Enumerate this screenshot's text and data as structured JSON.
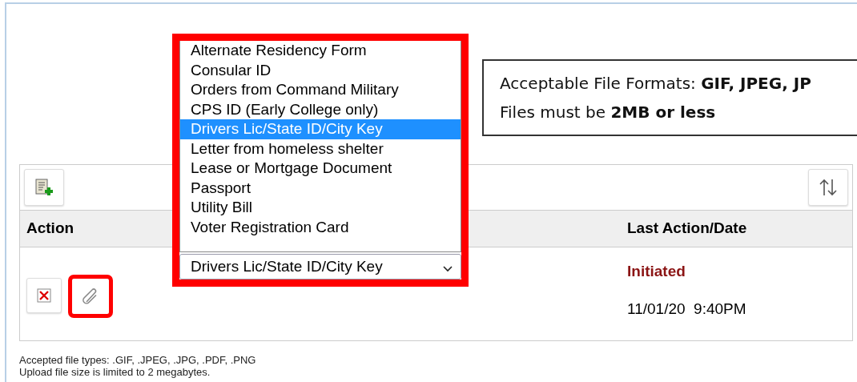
{
  "dropdown": {
    "options": [
      {
        "label": "Alternate Residency Form",
        "selected": false
      },
      {
        "label": "Consular ID",
        "selected": false
      },
      {
        "label": "Orders from Command Military",
        "selected": false
      },
      {
        "label": "CPS ID (Early College only)",
        "selected": false
      },
      {
        "label": "Drivers Lic/State ID/City Key",
        "selected": true
      },
      {
        "label": "Letter from homeless shelter",
        "selected": false
      },
      {
        "label": "Lease or Mortgage Document",
        "selected": false
      },
      {
        "label": "Passport",
        "selected": false
      },
      {
        "label": "Utility Bill",
        "selected": false
      },
      {
        "label": "Voter Registration Card",
        "selected": false
      }
    ],
    "value": "Drivers Lic/State ID/City Key",
    "highlighted": true
  },
  "callout": {
    "lines": [
      "Acceptable File Formats: **GIF, JPEG, JP**",
      "Files must be **2MB or less**"
    ]
  },
  "table": {
    "columns": [
      "Action",
      "Last Action/Date"
    ],
    "rows": [
      {
        "status": "Initiated",
        "date": "11/01/20  9:40PM",
        "attach_highlighted": true
      }
    ]
  },
  "footer": [
    "Accepted file types: .GIF, .JPEG, .JPG, .PDF, .PNG",
    "Upload file size is limited to 2 megabytes."
  ]
}
